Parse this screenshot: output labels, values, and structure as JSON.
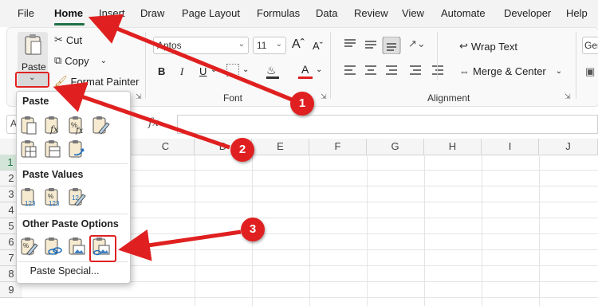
{
  "menu": {
    "file": "File",
    "home": "Home",
    "insert": "Insert",
    "draw": "Draw",
    "page_layout": "Page Layout",
    "formulas": "Formulas",
    "data": "Data",
    "review": "Review",
    "view": "View",
    "automate": "Automate",
    "developer": "Developer",
    "help": "Help"
  },
  "clipboard": {
    "paste": "Paste",
    "cut": "Cut",
    "copy": "Copy",
    "format_painter": "Format Painter"
  },
  "font": {
    "name_value": "Aptos",
    "size_value": "11",
    "group_label": "Font",
    "bold": "B",
    "italic": "I",
    "underline": "U"
  },
  "alignment": {
    "wrap_text": "Wrap Text",
    "merge_center": "Merge & Center",
    "group_label": "Alignment"
  },
  "number": {
    "format_value": "Ger"
  },
  "formula_bar": {
    "fx": "fx",
    "namebox_value": "A"
  },
  "columns": [
    "C",
    "D",
    "E",
    "F",
    "G",
    "H",
    "I",
    "J"
  ],
  "rows": [
    "1",
    "2",
    "3",
    "4",
    "5",
    "6",
    "7",
    "8",
    "9"
  ],
  "paste_menu": {
    "paste_header": "Paste",
    "paste_values_header": "Paste Values",
    "other_header": "Other Paste Options",
    "paste_special": "Paste Special...",
    "paste_icons": [
      "paste-icon",
      "paste-formulas-icon",
      "paste-formulas-number-format-icon",
      "keep-source-formatting-icon",
      "no-borders-icon",
      "keep-column-widths-icon",
      "transpose-icon"
    ],
    "value_icons": [
      "values-icon",
      "values-number-format-icon",
      "values-source-formatting-icon"
    ],
    "other_icons": [
      "formatting-icon",
      "paste-link-icon",
      "picture-icon",
      "linked-picture-icon"
    ]
  },
  "annotations": {
    "step1": "1",
    "step2": "2",
    "step3": "3"
  },
  "colors": {
    "accent": "#1e7145",
    "annotation": "#e02020",
    "font_color": "#e02020"
  }
}
